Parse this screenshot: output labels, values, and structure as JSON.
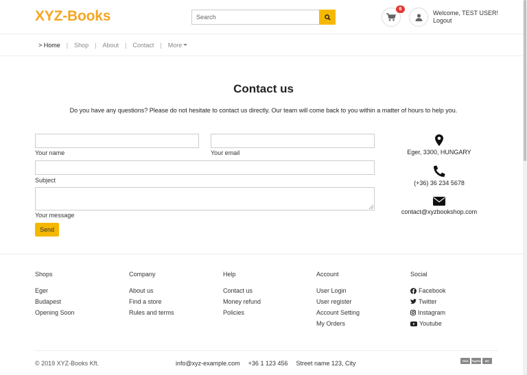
{
  "header": {
    "logo": "XYZ-Books",
    "search_placeholder": "Search",
    "cart_count": "6",
    "welcome": "Welcome, TEST USER!",
    "logout": "Logout"
  },
  "nav": {
    "items": [
      {
        "label": "> Home"
      },
      {
        "label": "Shop"
      },
      {
        "label": "About"
      },
      {
        "label": "Contact"
      },
      {
        "label": "More"
      }
    ]
  },
  "contact": {
    "title": "Contact us",
    "intro": "Do you have any questions? Please do not hesitate to contact us directly. Our team will come back to you within a matter of hours to help you.",
    "labels": {
      "name": "Your name",
      "email": "Your email",
      "subject": "Subject",
      "message": "Your message"
    },
    "send_label": "Send",
    "address": "Eger, 3300, HUNGARY",
    "phone": "(+36) 36 234 5678",
    "email": "contact@xyzbookshop.com"
  },
  "footer": {
    "columns": [
      {
        "title": "Shops",
        "items": [
          "Eger",
          "Budapest",
          "Opening Soon"
        ]
      },
      {
        "title": "Company",
        "items": [
          "About us",
          "Find a store",
          "Rules and terms"
        ]
      },
      {
        "title": "Help",
        "items": [
          "Contact us",
          "Money refund",
          "Policies"
        ]
      },
      {
        "title": "Account",
        "items": [
          "User Login",
          "User register",
          "Account Setting",
          "My Orders"
        ]
      },
      {
        "title": "Social",
        "items": [
          "Facebook",
          "Twitter",
          "Instagram",
          "Youtube"
        ]
      }
    ],
    "copyright": "© 2019 XYZ-Books Kft.",
    "bottom_email": "info@xyz-example.com",
    "bottom_phone": "+36 1 123 456",
    "bottom_address": "Street name 123, City",
    "payments": [
      "VISA",
      "PayPal",
      "MC"
    ]
  },
  "colors": {
    "accent": "#f5b800",
    "logo": "#f5a623",
    "badge": "#e53935"
  },
  "icons": [
    "search-icon",
    "cart-icon",
    "user-icon",
    "map-marker-icon",
    "phone-icon",
    "envelope-icon",
    "facebook-icon",
    "twitter-icon",
    "instagram-icon",
    "youtube-icon"
  ]
}
